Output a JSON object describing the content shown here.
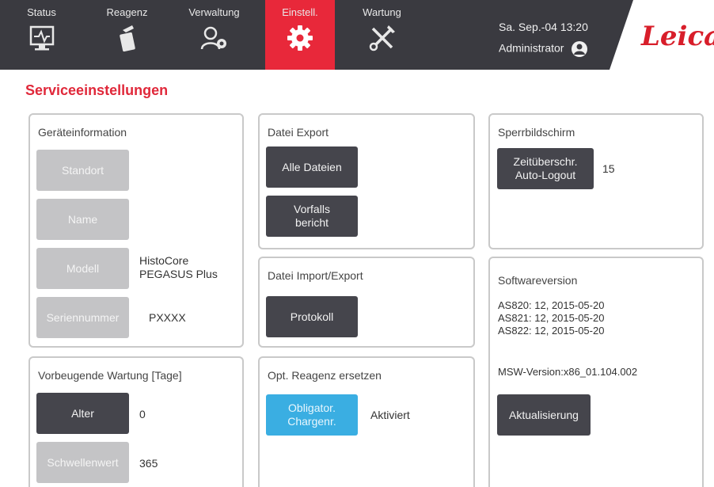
{
  "nav": {
    "items": [
      {
        "label": "Status",
        "icon": "monitor-icon"
      },
      {
        "label": "Reagenz",
        "icon": "reagent-bottle-icon"
      },
      {
        "label": "Verwaltung",
        "icon": "admin-users-icon"
      },
      {
        "label": "Einstell.",
        "icon": "gear-icon"
      },
      {
        "label": "Wartung",
        "icon": "tools-icon"
      }
    ],
    "active": "Einstell."
  },
  "header": {
    "datetime": "Sa. Sep.-04 13:20",
    "user": "Administrator",
    "logo": "Leica"
  },
  "page_title": "Serviceeinstellungen",
  "device_info": {
    "title": "Geräteinformation",
    "location_label": "Standort",
    "name_label": "Name",
    "model_label": "Modell",
    "model_value_line1": "HistoCore",
    "model_value_line2": "PEGASUS Plus",
    "serial_label": "Seriennummer",
    "serial_value": "PXXXX"
  },
  "file_export": {
    "title": "Datei Export",
    "all_files_label": "Alle Dateien",
    "incident_report_line1": "Vorfalls",
    "incident_report_line2": "bericht"
  },
  "lock_screen": {
    "title": "Sperrbildschirm",
    "timeout_line1": "Zeitüberschr.",
    "timeout_line2": "Auto-Logout",
    "timeout_value": "15"
  },
  "file_import_export": {
    "title": "Datei Import/Export",
    "protocol_label": "Protokoll"
  },
  "software": {
    "title": "Softwareversion",
    "as820": "AS820: 12, 2015-05-20",
    "as821": "AS821: 12, 2015-05-20",
    "as822": "AS822: 12, 2015-05-20",
    "msw": "MSW-Version:x86_01.104.002",
    "update_label": "Aktualisierung"
  },
  "preventive_maintenance": {
    "title": "Vorbeugende Wartung [Tage]",
    "age_label": "Alter",
    "age_value": "0",
    "threshold_label": "Schwellenwert",
    "threshold_value": "365"
  },
  "reagent_replace": {
    "title": "Opt. Reagenz ersetzen",
    "mandatory_line1": "Obligator.",
    "mandatory_line2": "Chargenr.",
    "status": "Aktiviert"
  },
  "colors": {
    "accent_red": "#e0283a",
    "topbar": "#3a3a40",
    "button_dark": "#45454c",
    "button_disabled": "#c4c4c6",
    "button_blue": "#3aaee2"
  }
}
